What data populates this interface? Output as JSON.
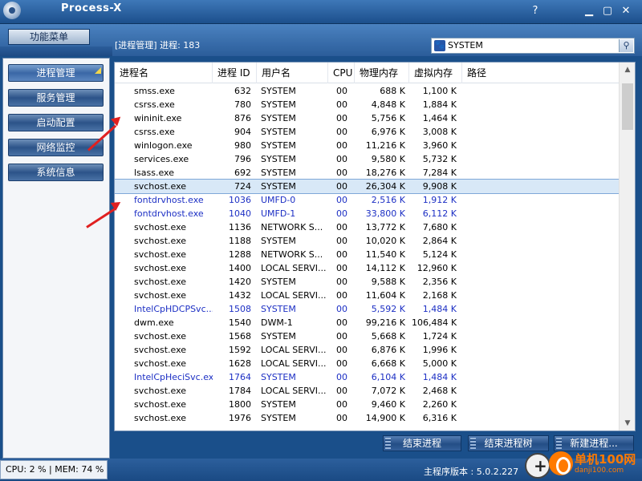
{
  "window": {
    "title": "Process-X",
    "controls": [
      "help-icon",
      "minimize-icon",
      "maximize-icon",
      "close-icon"
    ]
  },
  "toolbar": {
    "menu_label": "功能菜单",
    "panel_title": "[进程管理] 进程: 183",
    "search_value": "SYSTEM"
  },
  "sidebar": {
    "items": [
      {
        "label": "进程管理",
        "active": true
      },
      {
        "label": "服务管理",
        "active": false
      },
      {
        "label": "启动配置",
        "active": false
      },
      {
        "label": "网络监控",
        "active": false
      },
      {
        "label": "系统信息",
        "active": false
      }
    ]
  },
  "list": {
    "columns": [
      "进程名",
      "进程 ID",
      "用户名",
      "CPU",
      "物理内存",
      "虚拟内存",
      "路径"
    ],
    "rows": [
      {
        "name": "smss.exe",
        "pid": "632",
        "user": "SYSTEM",
        "cpu": "00",
        "pmem": "688 K",
        "vmem": "1,100 K",
        "kind": "system"
      },
      {
        "name": "csrss.exe",
        "pid": "780",
        "user": "SYSTEM",
        "cpu": "00",
        "pmem": "4,848 K",
        "vmem": "1,884 K",
        "kind": "system"
      },
      {
        "name": "wininit.exe",
        "pid": "876",
        "user": "SYSTEM",
        "cpu": "00",
        "pmem": "5,756 K",
        "vmem": "1,464 K",
        "kind": "system"
      },
      {
        "name": "csrss.exe",
        "pid": "904",
        "user": "SYSTEM",
        "cpu": "00",
        "pmem": "6,976 K",
        "vmem": "3,008 K",
        "kind": "system"
      },
      {
        "name": "winlogon.exe",
        "pid": "980",
        "user": "SYSTEM",
        "cpu": "00",
        "pmem": "11,216 K",
        "vmem": "3,960 K",
        "kind": "system"
      },
      {
        "name": "services.exe",
        "pid": "796",
        "user": "SYSTEM",
        "cpu": "00",
        "pmem": "9,580 K",
        "vmem": "5,732 K",
        "kind": "system"
      },
      {
        "name": "lsass.exe",
        "pid": "692",
        "user": "SYSTEM",
        "cpu": "00",
        "pmem": "18,276 K",
        "vmem": "7,284 K",
        "kind": "system"
      },
      {
        "name": "svchost.exe",
        "pid": "724",
        "user": "SYSTEM",
        "cpu": "00",
        "pmem": "26,304 K",
        "vmem": "9,908 K",
        "kind": "selected"
      },
      {
        "name": "fontdrvhost.exe",
        "pid": "1036",
        "user": "UMFD-0",
        "cpu": "00",
        "pmem": "2,516 K",
        "vmem": "1,912 K",
        "kind": "user"
      },
      {
        "name": "fontdrvhost.exe",
        "pid": "1040",
        "user": "UMFD-1",
        "cpu": "00",
        "pmem": "33,800 K",
        "vmem": "6,112 K",
        "kind": "user"
      },
      {
        "name": "svchost.exe",
        "pid": "1136",
        "user": "NETWORK S...",
        "cpu": "00",
        "pmem": "13,772 K",
        "vmem": "7,680 K",
        "kind": "system"
      },
      {
        "name": "svchost.exe",
        "pid": "1188",
        "user": "SYSTEM",
        "cpu": "00",
        "pmem": "10,020 K",
        "vmem": "2,864 K",
        "kind": "system"
      },
      {
        "name": "svchost.exe",
        "pid": "1288",
        "user": "NETWORK S...",
        "cpu": "00",
        "pmem": "11,540 K",
        "vmem": "5,124 K",
        "kind": "system"
      },
      {
        "name": "svchost.exe",
        "pid": "1400",
        "user": "LOCAL SERVI...",
        "cpu": "00",
        "pmem": "14,112 K",
        "vmem": "12,960 K",
        "kind": "system"
      },
      {
        "name": "svchost.exe",
        "pid": "1420",
        "user": "SYSTEM",
        "cpu": "00",
        "pmem": "9,588 K",
        "vmem": "2,356 K",
        "kind": "system"
      },
      {
        "name": "svchost.exe",
        "pid": "1432",
        "user": "LOCAL SERVI...",
        "cpu": "00",
        "pmem": "11,604 K",
        "vmem": "2,168 K",
        "kind": "system"
      },
      {
        "name": "IntelCpHDCPSvc....",
        "pid": "1508",
        "user": "SYSTEM",
        "cpu": "00",
        "pmem": "5,592 K",
        "vmem": "1,484 K",
        "kind": "user"
      },
      {
        "name": "dwm.exe",
        "pid": "1540",
        "user": "DWM-1",
        "cpu": "00",
        "pmem": "99,216 K",
        "vmem": "106,484 K",
        "kind": "system"
      },
      {
        "name": "svchost.exe",
        "pid": "1568",
        "user": "SYSTEM",
        "cpu": "00",
        "pmem": "5,668 K",
        "vmem": "1,724 K",
        "kind": "system"
      },
      {
        "name": "svchost.exe",
        "pid": "1592",
        "user": "LOCAL SERVI...",
        "cpu": "00",
        "pmem": "6,876 K",
        "vmem": "1,996 K",
        "kind": "system"
      },
      {
        "name": "svchost.exe",
        "pid": "1628",
        "user": "LOCAL SERVI...",
        "cpu": "00",
        "pmem": "6,668 K",
        "vmem": "5,000 K",
        "kind": "system"
      },
      {
        "name": "IntelCpHeciSvc.exe",
        "pid": "1764",
        "user": "SYSTEM",
        "cpu": "00",
        "pmem": "6,104 K",
        "vmem": "1,484 K",
        "kind": "user"
      },
      {
        "name": "svchost.exe",
        "pid": "1784",
        "user": "LOCAL SERVI...",
        "cpu": "00",
        "pmem": "7,072 K",
        "vmem": "2,468 K",
        "kind": "system"
      },
      {
        "name": "svchost.exe",
        "pid": "1800",
        "user": "SYSTEM",
        "cpu": "00",
        "pmem": "9,460 K",
        "vmem": "2,260 K",
        "kind": "system"
      },
      {
        "name": "svchost.exe",
        "pid": "1976",
        "user": "SYSTEM",
        "cpu": "00",
        "pmem": "14,900 K",
        "vmem": "6,316 K",
        "kind": "system"
      }
    ]
  },
  "actions": {
    "end_process": "结束进程",
    "end_tree": "结束进程树",
    "new_process": "新建进程..."
  },
  "status": {
    "left": "CPU: 2 % | MEM: 74 %",
    "version": "主程序版本 : 5.0.2.227"
  },
  "watermark": {
    "text": "单机100网",
    "url": "danji100.com"
  },
  "colors": {
    "system_row": "#000000",
    "user_row": "#1c2fc4",
    "selected_bg": "#d8e8f7",
    "annotation_arrow": "#e02020",
    "watermark": "#ff7a00"
  }
}
